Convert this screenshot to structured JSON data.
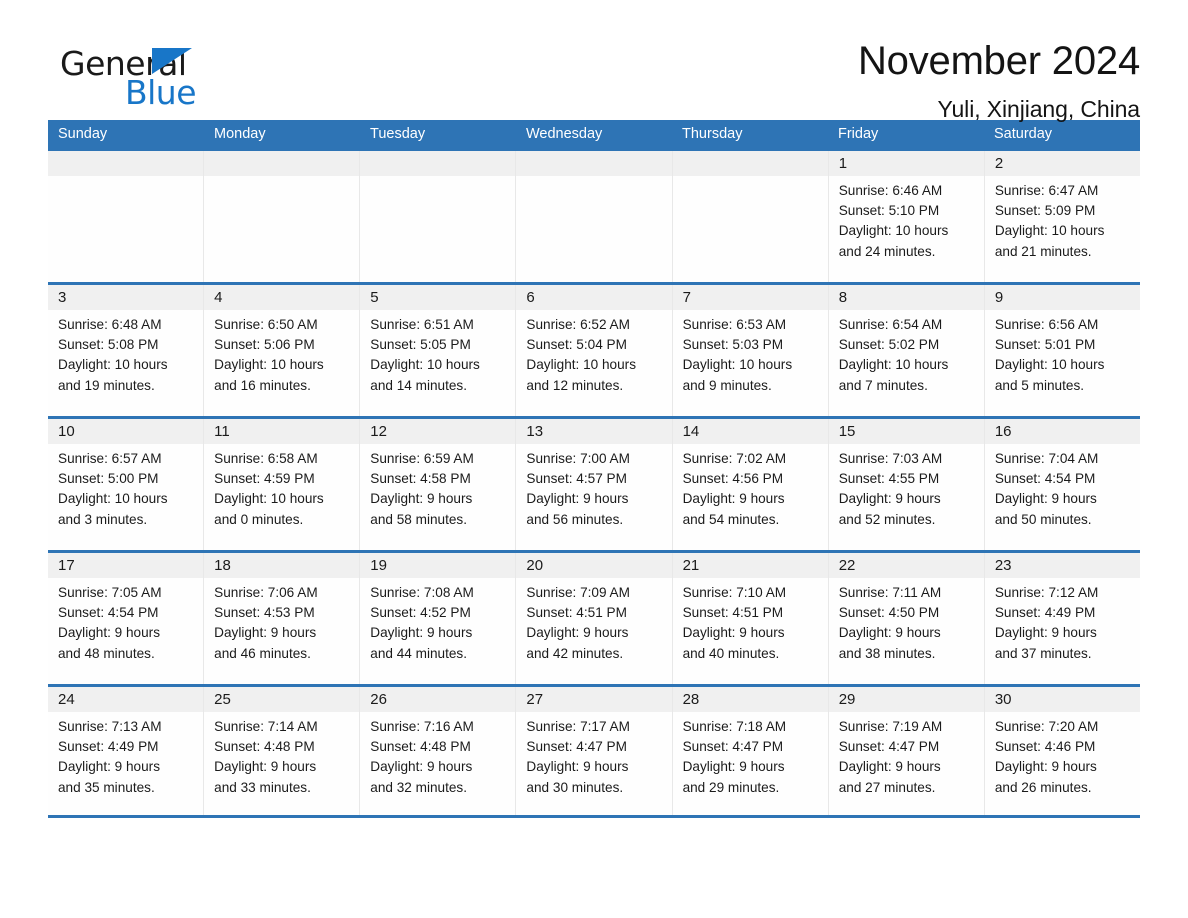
{
  "brand": {
    "name_part1": "General",
    "name_part2": "Blue",
    "accent_color": "#1876c8"
  },
  "header": {
    "month_title": "November 2024",
    "location": "Yuli, Xinjiang, China",
    "header_bg_color": "#2e74b5"
  },
  "calendar": {
    "weekday_headers": [
      "Sunday",
      "Monday",
      "Tuesday",
      "Wednesday",
      "Thursday",
      "Friday",
      "Saturday"
    ],
    "weeks": [
      [
        {
          "day": "",
          "sunrise": "",
          "sunset": "",
          "daylight1": "",
          "daylight2": "",
          "empty": true
        },
        {
          "day": "",
          "sunrise": "",
          "sunset": "",
          "daylight1": "",
          "daylight2": "",
          "empty": true
        },
        {
          "day": "",
          "sunrise": "",
          "sunset": "",
          "daylight1": "",
          "daylight2": "",
          "empty": true
        },
        {
          "day": "",
          "sunrise": "",
          "sunset": "",
          "daylight1": "",
          "daylight2": "",
          "empty": true
        },
        {
          "day": "",
          "sunrise": "",
          "sunset": "",
          "daylight1": "",
          "daylight2": "",
          "empty": true
        },
        {
          "day": "1",
          "sunrise": "Sunrise: 6:46 AM",
          "sunset": "Sunset: 5:10 PM",
          "daylight1": "Daylight: 10 hours",
          "daylight2": "and 24 minutes.",
          "empty": false
        },
        {
          "day": "2",
          "sunrise": "Sunrise: 6:47 AM",
          "sunset": "Sunset: 5:09 PM",
          "daylight1": "Daylight: 10 hours",
          "daylight2": "and 21 minutes.",
          "empty": false
        }
      ],
      [
        {
          "day": "3",
          "sunrise": "Sunrise: 6:48 AM",
          "sunset": "Sunset: 5:08 PM",
          "daylight1": "Daylight: 10 hours",
          "daylight2": "and 19 minutes.",
          "empty": false
        },
        {
          "day": "4",
          "sunrise": "Sunrise: 6:50 AM",
          "sunset": "Sunset: 5:06 PM",
          "daylight1": "Daylight: 10 hours",
          "daylight2": "and 16 minutes.",
          "empty": false
        },
        {
          "day": "5",
          "sunrise": "Sunrise: 6:51 AM",
          "sunset": "Sunset: 5:05 PM",
          "daylight1": "Daylight: 10 hours",
          "daylight2": "and 14 minutes.",
          "empty": false
        },
        {
          "day": "6",
          "sunrise": "Sunrise: 6:52 AM",
          "sunset": "Sunset: 5:04 PM",
          "daylight1": "Daylight: 10 hours",
          "daylight2": "and 12 minutes.",
          "empty": false
        },
        {
          "day": "7",
          "sunrise": "Sunrise: 6:53 AM",
          "sunset": "Sunset: 5:03 PM",
          "daylight1": "Daylight: 10 hours",
          "daylight2": "and 9 minutes.",
          "empty": false
        },
        {
          "day": "8",
          "sunrise": "Sunrise: 6:54 AM",
          "sunset": "Sunset: 5:02 PM",
          "daylight1": "Daylight: 10 hours",
          "daylight2": "and 7 minutes.",
          "empty": false
        },
        {
          "day": "9",
          "sunrise": "Sunrise: 6:56 AM",
          "sunset": "Sunset: 5:01 PM",
          "daylight1": "Daylight: 10 hours",
          "daylight2": "and 5 minutes.",
          "empty": false
        }
      ],
      [
        {
          "day": "10",
          "sunrise": "Sunrise: 6:57 AM",
          "sunset": "Sunset: 5:00 PM",
          "daylight1": "Daylight: 10 hours",
          "daylight2": "and 3 minutes.",
          "empty": false
        },
        {
          "day": "11",
          "sunrise": "Sunrise: 6:58 AM",
          "sunset": "Sunset: 4:59 PM",
          "daylight1": "Daylight: 10 hours",
          "daylight2": "and 0 minutes.",
          "empty": false
        },
        {
          "day": "12",
          "sunrise": "Sunrise: 6:59 AM",
          "sunset": "Sunset: 4:58 PM",
          "daylight1": "Daylight: 9 hours",
          "daylight2": "and 58 minutes.",
          "empty": false
        },
        {
          "day": "13",
          "sunrise": "Sunrise: 7:00 AM",
          "sunset": "Sunset: 4:57 PM",
          "daylight1": "Daylight: 9 hours",
          "daylight2": "and 56 minutes.",
          "empty": false
        },
        {
          "day": "14",
          "sunrise": "Sunrise: 7:02 AM",
          "sunset": "Sunset: 4:56 PM",
          "daylight1": "Daylight: 9 hours",
          "daylight2": "and 54 minutes.",
          "empty": false
        },
        {
          "day": "15",
          "sunrise": "Sunrise: 7:03 AM",
          "sunset": "Sunset: 4:55 PM",
          "daylight1": "Daylight: 9 hours",
          "daylight2": "and 52 minutes.",
          "empty": false
        },
        {
          "day": "16",
          "sunrise": "Sunrise: 7:04 AM",
          "sunset": "Sunset: 4:54 PM",
          "daylight1": "Daylight: 9 hours",
          "daylight2": "and 50 minutes.",
          "empty": false
        }
      ],
      [
        {
          "day": "17",
          "sunrise": "Sunrise: 7:05 AM",
          "sunset": "Sunset: 4:54 PM",
          "daylight1": "Daylight: 9 hours",
          "daylight2": "and 48 minutes.",
          "empty": false
        },
        {
          "day": "18",
          "sunrise": "Sunrise: 7:06 AM",
          "sunset": "Sunset: 4:53 PM",
          "daylight1": "Daylight: 9 hours",
          "daylight2": "and 46 minutes.",
          "empty": false
        },
        {
          "day": "19",
          "sunrise": "Sunrise: 7:08 AM",
          "sunset": "Sunset: 4:52 PM",
          "daylight1": "Daylight: 9 hours",
          "daylight2": "and 44 minutes.",
          "empty": false
        },
        {
          "day": "20",
          "sunrise": "Sunrise: 7:09 AM",
          "sunset": "Sunset: 4:51 PM",
          "daylight1": "Daylight: 9 hours",
          "daylight2": "and 42 minutes.",
          "empty": false
        },
        {
          "day": "21",
          "sunrise": "Sunrise: 7:10 AM",
          "sunset": "Sunset: 4:51 PM",
          "daylight1": "Daylight: 9 hours",
          "daylight2": "and 40 minutes.",
          "empty": false
        },
        {
          "day": "22",
          "sunrise": "Sunrise: 7:11 AM",
          "sunset": "Sunset: 4:50 PM",
          "daylight1": "Daylight: 9 hours",
          "daylight2": "and 38 minutes.",
          "empty": false
        },
        {
          "day": "23",
          "sunrise": "Sunrise: 7:12 AM",
          "sunset": "Sunset: 4:49 PM",
          "daylight1": "Daylight: 9 hours",
          "daylight2": "and 37 minutes.",
          "empty": false
        }
      ],
      [
        {
          "day": "24",
          "sunrise": "Sunrise: 7:13 AM",
          "sunset": "Sunset: 4:49 PM",
          "daylight1": "Daylight: 9 hours",
          "daylight2": "and 35 minutes.",
          "empty": false
        },
        {
          "day": "25",
          "sunrise": "Sunrise: 7:14 AM",
          "sunset": "Sunset: 4:48 PM",
          "daylight1": "Daylight: 9 hours",
          "daylight2": "and 33 minutes.",
          "empty": false
        },
        {
          "day": "26",
          "sunrise": "Sunrise: 7:16 AM",
          "sunset": "Sunset: 4:48 PM",
          "daylight1": "Daylight: 9 hours",
          "daylight2": "and 32 minutes.",
          "empty": false
        },
        {
          "day": "27",
          "sunrise": "Sunrise: 7:17 AM",
          "sunset": "Sunset: 4:47 PM",
          "daylight1": "Daylight: 9 hours",
          "daylight2": "and 30 minutes.",
          "empty": false
        },
        {
          "day": "28",
          "sunrise": "Sunrise: 7:18 AM",
          "sunset": "Sunset: 4:47 PM",
          "daylight1": "Daylight: 9 hours",
          "daylight2": "and 29 minutes.",
          "empty": false
        },
        {
          "day": "29",
          "sunrise": "Sunrise: 7:19 AM",
          "sunset": "Sunset: 4:47 PM",
          "daylight1": "Daylight: 9 hours",
          "daylight2": "and 27 minutes.",
          "empty": false
        },
        {
          "day": "30",
          "sunrise": "Sunrise: 7:20 AM",
          "sunset": "Sunset: 4:46 PM",
          "daylight1": "Daylight: 9 hours",
          "daylight2": "and 26 minutes.",
          "empty": false
        }
      ]
    ]
  }
}
